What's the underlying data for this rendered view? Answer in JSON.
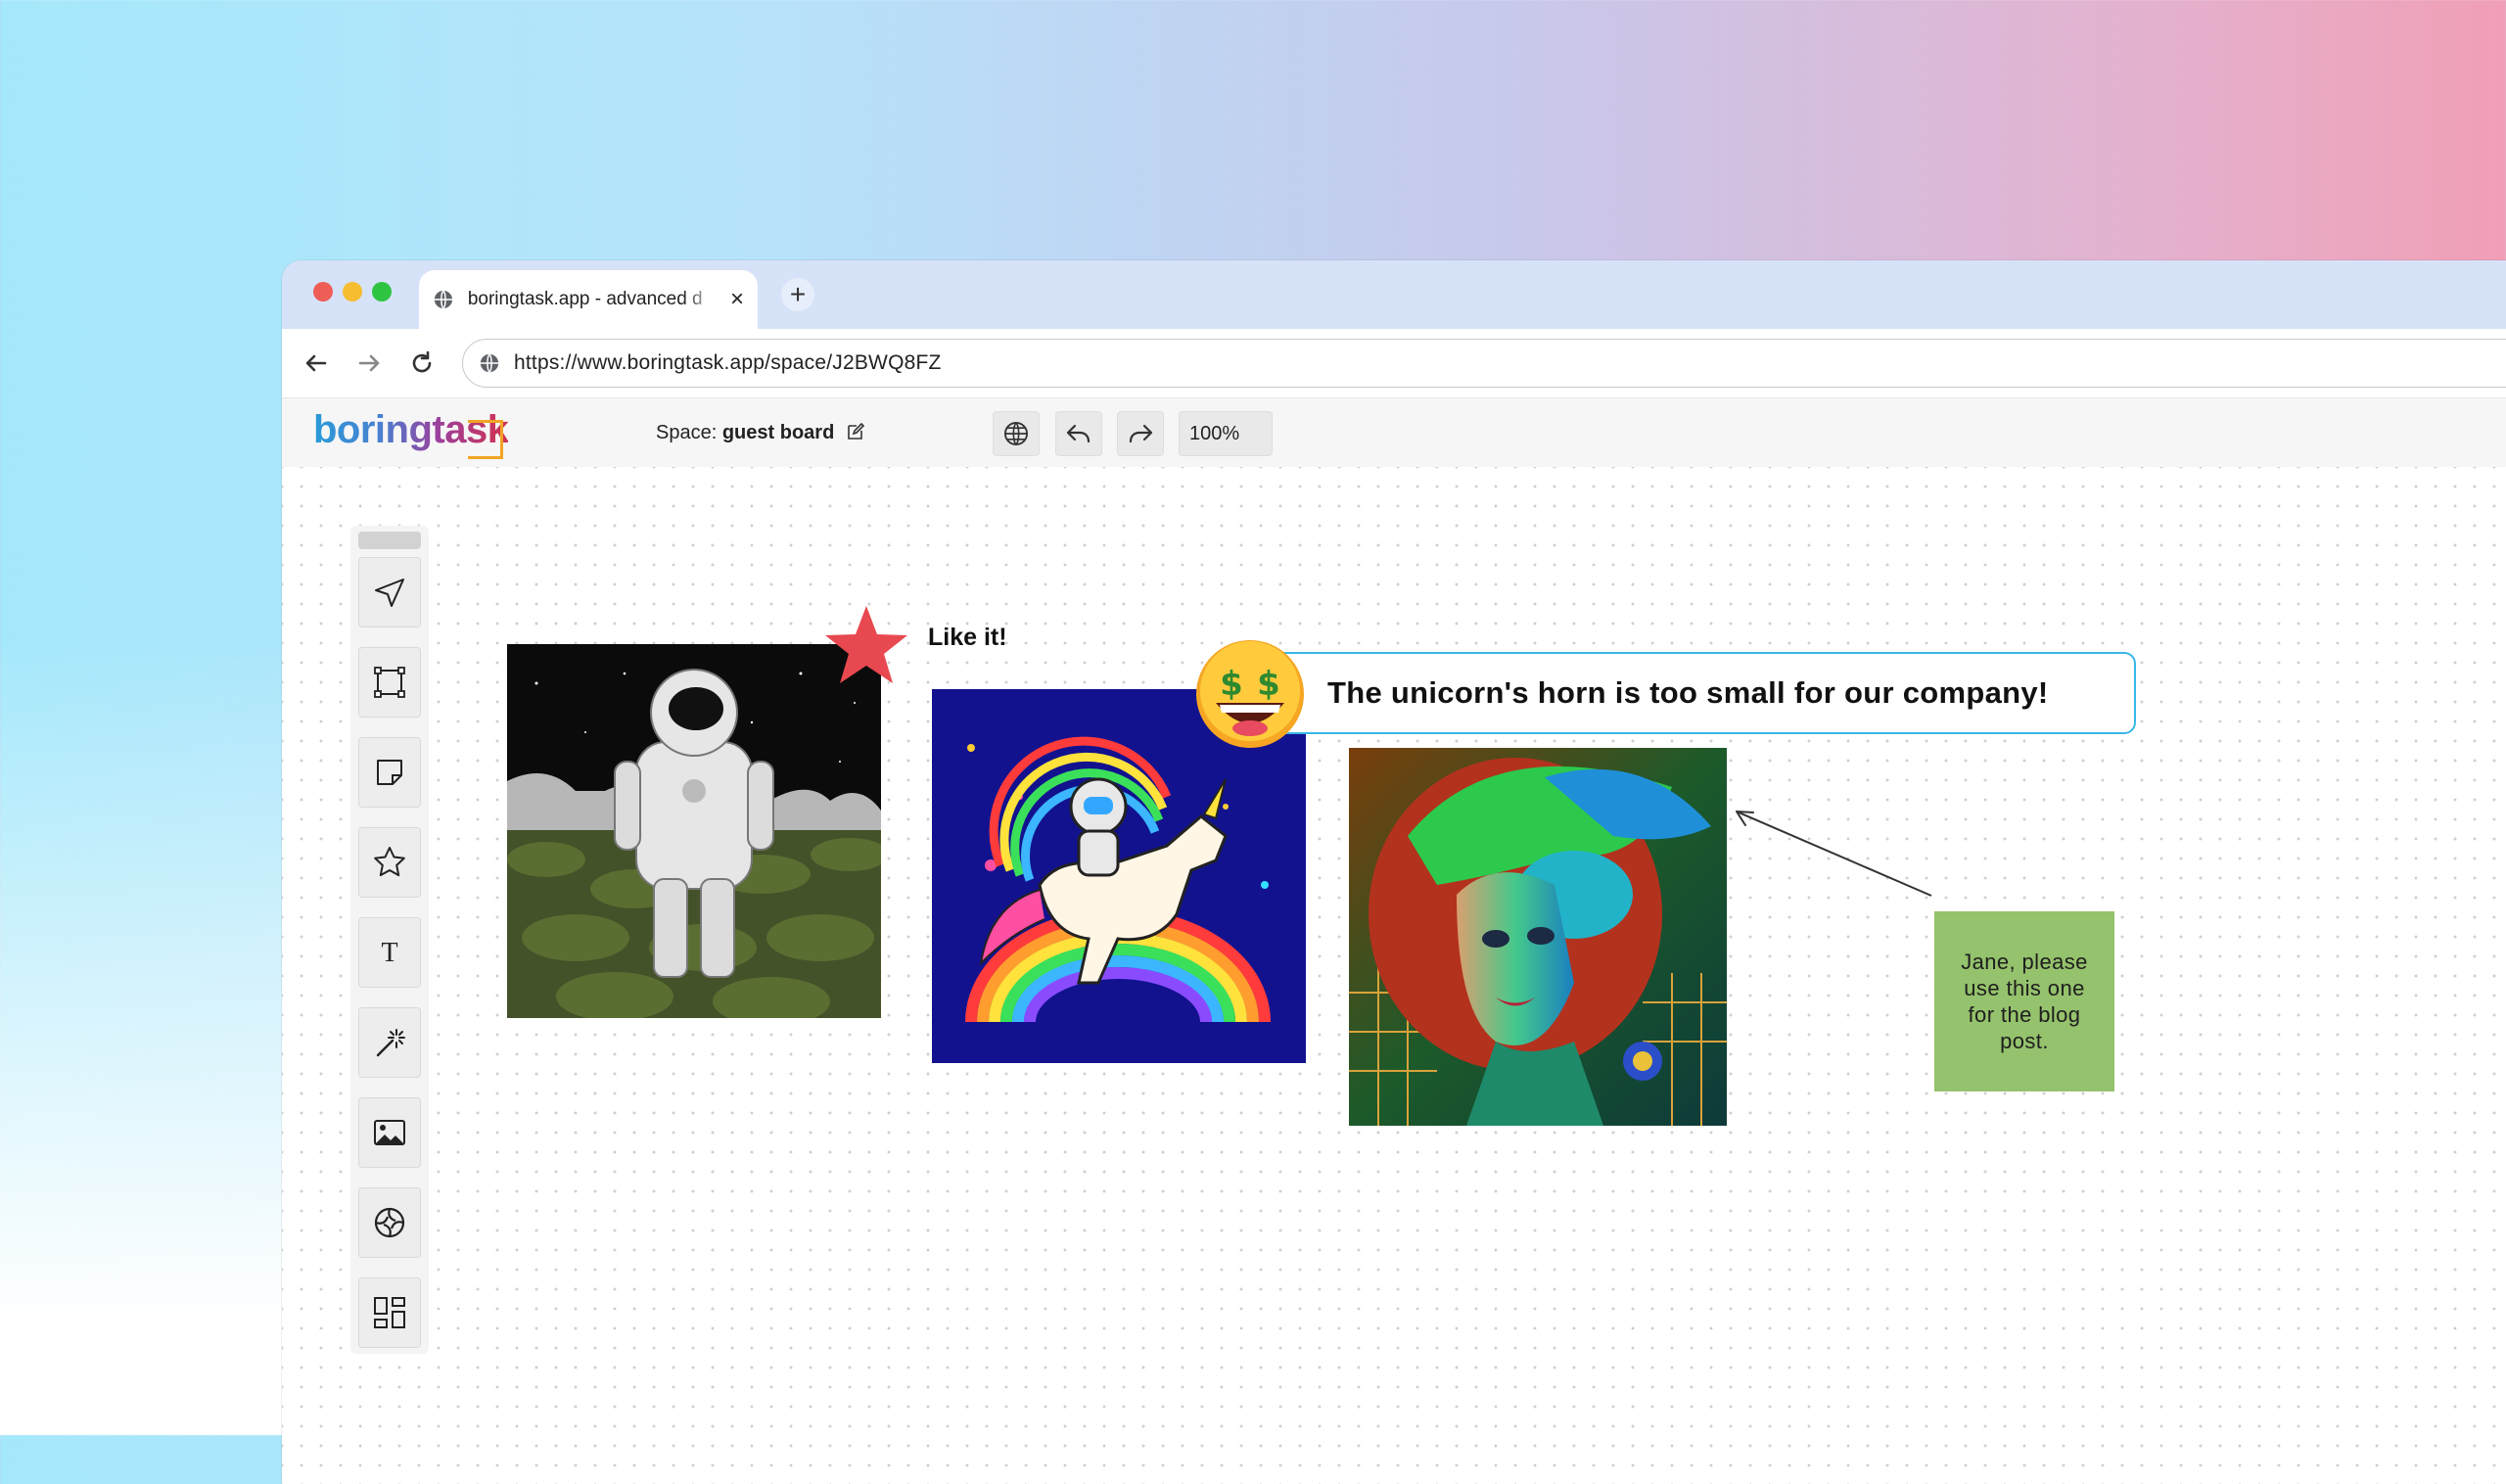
{
  "browser": {
    "tab_title": "boringtask.app - advanced d",
    "new_tab_label": "+",
    "close_tab_label": "×",
    "url": "https://www.boringtask.app/space/J2BWQ8FZ"
  },
  "app": {
    "logo": "boringtask",
    "space_label": "Space:",
    "space_name": "guest board",
    "zoom": "100%"
  },
  "toolbar": {
    "tools": [
      "select",
      "frame",
      "sticky-note",
      "star",
      "text",
      "magic-wand",
      "image",
      "aperture",
      "layout"
    ]
  },
  "canvas": {
    "like_label": "Like it!",
    "comment": "The unicorn's horn is too small for our company!",
    "note_text": "Jane, please use this one for the blog post."
  },
  "colors": {
    "note": "#95c26c",
    "star": "#e8484f",
    "bubble_border": "#38b7e8"
  }
}
